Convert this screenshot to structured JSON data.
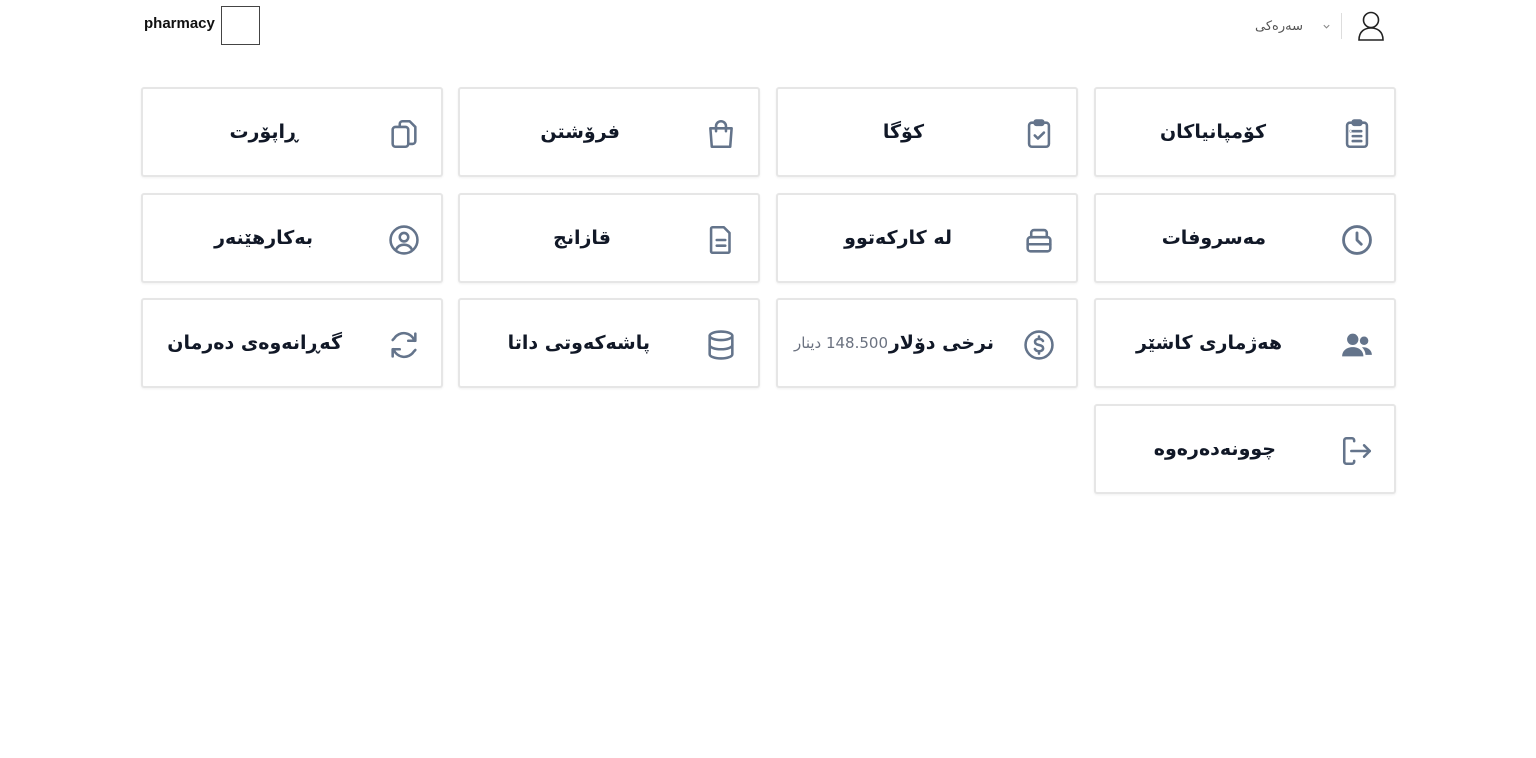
{
  "header": {
    "brand": "pharmacy",
    "user_menu_label": "سەرەکی"
  },
  "cards": [
    {
      "label": "کۆمپانیاکان",
      "icon": "clipboard-list-icon"
    },
    {
      "label": "کۆگا",
      "icon": "clipboard-check-icon"
    },
    {
      "label": "فرۆشتن",
      "icon": "shopping-bag-icon"
    },
    {
      "label": "ڕاپۆرت",
      "icon": "copy-documents-icon"
    },
    {
      "label": "مەسروفات",
      "icon": "clock-icon"
    },
    {
      "label": "لە کارکەتوو",
      "icon": "archive-box-icon"
    },
    {
      "label": "قازانج",
      "icon": "document-icon"
    },
    {
      "label": "بەکارهێنەر",
      "icon": "user-circle-icon"
    },
    {
      "label": "هەژماری کاشێر",
      "icon": "users-icon"
    },
    {
      "label": "نرخی دۆلار",
      "icon": "dollar-circle-icon",
      "value": "148.500 دینار"
    },
    {
      "label": "پاشەکەوتی داتا",
      "icon": "database-icon"
    },
    {
      "label": "گەڕانەوەی دەرمان",
      "icon": "refresh-icon"
    },
    {
      "label": "چوونەدەرەوە",
      "icon": "logout-icon"
    }
  ],
  "colors": {
    "icon": "#64748b",
    "border": "#e6e6e6",
    "text": "#111827",
    "muted": "#6b7280"
  }
}
